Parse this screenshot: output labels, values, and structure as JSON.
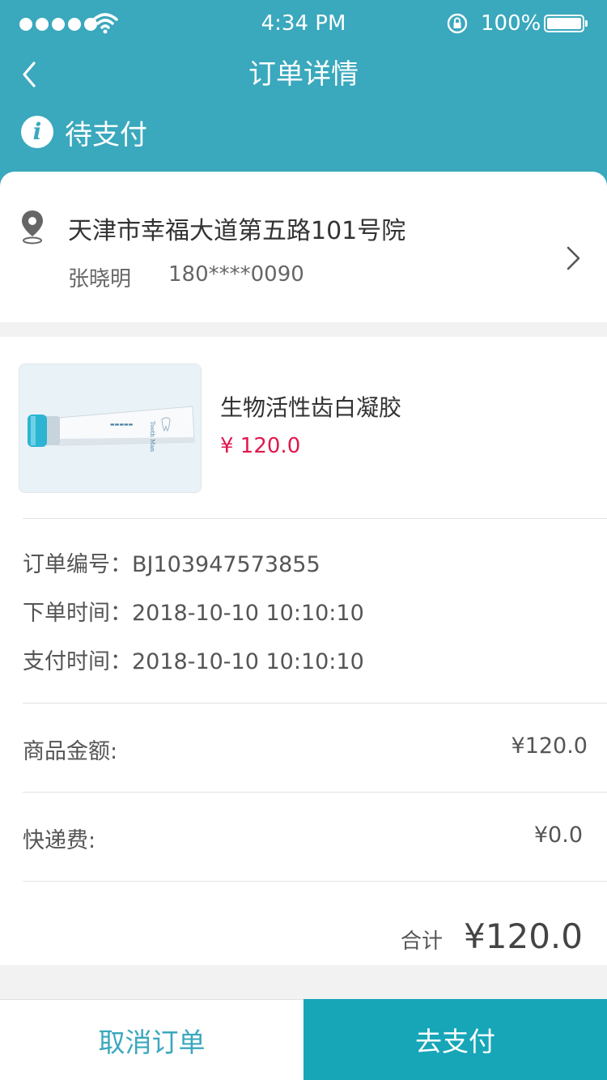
{
  "status_bar": {
    "time": "4:34 PM",
    "battery": "100%"
  },
  "nav": {
    "title": "订单详情"
  },
  "order_status": {
    "label": "待支付",
    "icon": "info-icon"
  },
  "address": {
    "line": "天津市幸福大道第五路101号院",
    "name": "张晓明",
    "phone": "180****0090"
  },
  "product": {
    "name": "生物活性齿白凝胶",
    "price": "¥ 120.0",
    "tube_text": "Tooth Man"
  },
  "order_info": [
    {
      "label": "订单编号：",
      "value": "BJ103947573855"
    },
    {
      "label": "下单时间：",
      "value": "2018-10-10 10:10:10"
    },
    {
      "label": "支付时间：",
      "value": "2018-10-10 10:10:10"
    }
  ],
  "fees": {
    "goods_label": "商品金额:",
    "goods_value": "¥120.0",
    "shipping_label": "快递费:",
    "shipping_value": "¥0.0"
  },
  "total": {
    "label": "合计",
    "value": "¥120.0"
  },
  "actions": {
    "cancel": "取消订单",
    "pay": "去支付"
  },
  "colors": {
    "primary": "#3aa8bd",
    "pay_button": "#17a6b8",
    "price": "#e0194f"
  }
}
